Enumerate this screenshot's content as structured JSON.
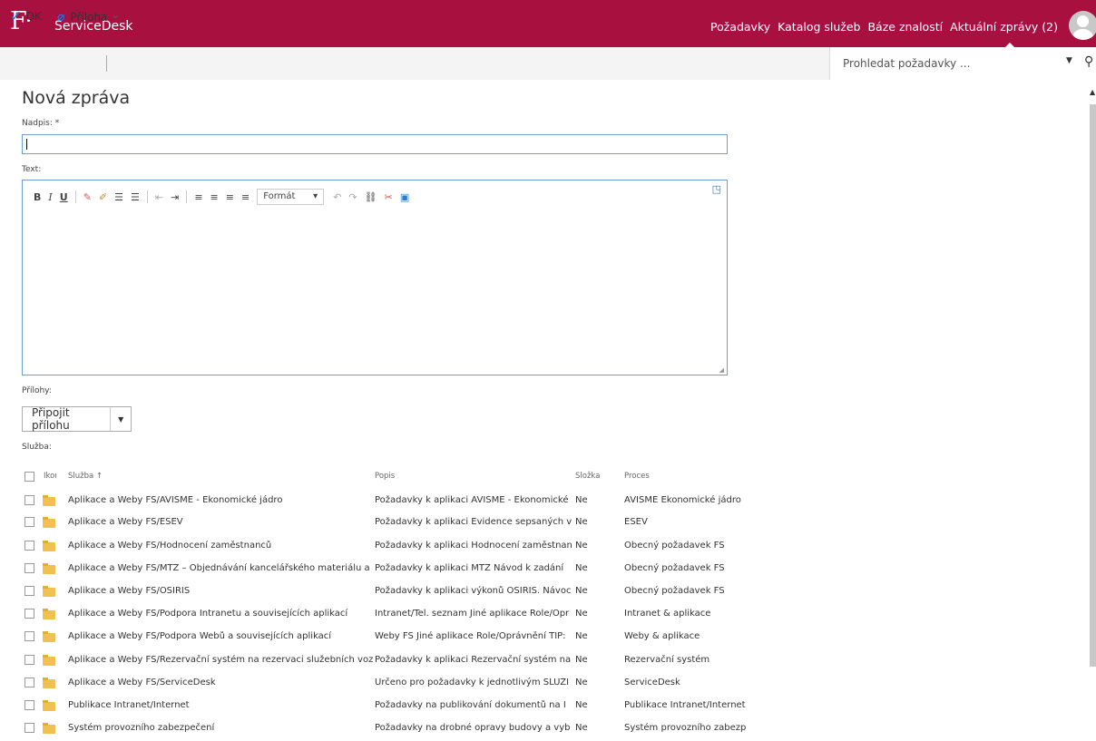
{
  "header": {
    "logo": "F",
    "app_name": "ServiceDesk",
    "nav": [
      "Požadavky",
      "Katalog služeb",
      "Báze znalostí",
      "Aktuální zprávy (2)"
    ],
    "accent_color": "#a8113f"
  },
  "commandbar": {
    "ok_label": "OK",
    "attach_label": "Příloha",
    "search_placeholder": "Prohledat požadavky ..."
  },
  "form": {
    "title": "Nová zpráva",
    "nadpis_label": "Nadpis: *",
    "nadpis_value": "",
    "text_label": "Text:",
    "format_label": "Formát",
    "prilohy_label": "Přílohy:",
    "attach_button": "Připojit přílohu",
    "sluzba_label": "Služba:"
  },
  "table": {
    "headers": {
      "ikona": "Ikona",
      "sluzba": "Služba ↑",
      "popis": "Popis",
      "slozka": "Složka",
      "proces": "Proces"
    },
    "rows": [
      {
        "sluzba": "Aplikace a Weby FS/AVISME - Ekonomické jádro",
        "popis": "Požadavky k aplikaci AVISME - Ekonomické",
        "slozka": "Ne",
        "proces": "AVISME Ekonomické jádro"
      },
      {
        "sluzba": "Aplikace a Weby FS/ESEV",
        "popis": "Požadavky k aplikaci Evidence sepsaných v",
        "slozka": "Ne",
        "proces": "ESEV"
      },
      {
        "sluzba": "Aplikace a Weby FS/Hodnocení zaměstnanců",
        "popis": "Požadavky k aplikaci Hodnocení zaměstnan",
        "slozka": "Ne",
        "proces": "Obecný požadavek FS"
      },
      {
        "sluzba": "Aplikace a Weby FS/MTZ – Objednávání kancelářského materiálu a l",
        "popis": "Požadavky k aplikaci MTZ Návod k zadání",
        "slozka": "Ne",
        "proces": "Obecný požadavek FS"
      },
      {
        "sluzba": "Aplikace a Weby FS/OSIRIS",
        "popis": "Požadavky k aplikaci výkonů OSIRIS. Návoc",
        "slozka": "Ne",
        "proces": "Obecný požadavek FS"
      },
      {
        "sluzba": "Aplikace a Weby FS/Podpora Intranetu a souvisejících aplikací",
        "popis": "Intranet/Tel. seznam Jiné aplikace Role/Opr",
        "slozka": "Ne",
        "proces": "Intranet & aplikace"
      },
      {
        "sluzba": "Aplikace a Weby FS/Podpora Webů a souvisejících aplikací",
        "popis": "Weby FS Jiné aplikace Role/Oprávnění TIP:",
        "slozka": "Ne",
        "proces": "Weby & aplikace"
      },
      {
        "sluzba": "Aplikace a Weby FS/Rezervační systém na rezervaci služebních vozi",
        "popis": "Požadavky k aplikaci Rezervační systém na",
        "slozka": "Ne",
        "proces": "Rezervační systém"
      },
      {
        "sluzba": "Aplikace a Weby FS/ServiceDesk",
        "popis": "Určeno pro požadavky k jednotlivým SLUŽI",
        "slozka": "Ne",
        "proces": "ServiceDesk"
      },
      {
        "sluzba": "Publikace Intranet/Internet",
        "popis": "Požadavky na publikování dokumentů na I",
        "slozka": "Ne",
        "proces": "Publikace Intranet/Internet"
      },
      {
        "sluzba": "Systém provozního zabezpečení",
        "popis": "Požadavky na drobné opravy budovy a vyb",
        "slozka": "Ne",
        "proces": "Systém provozního zabezp"
      }
    ]
  }
}
